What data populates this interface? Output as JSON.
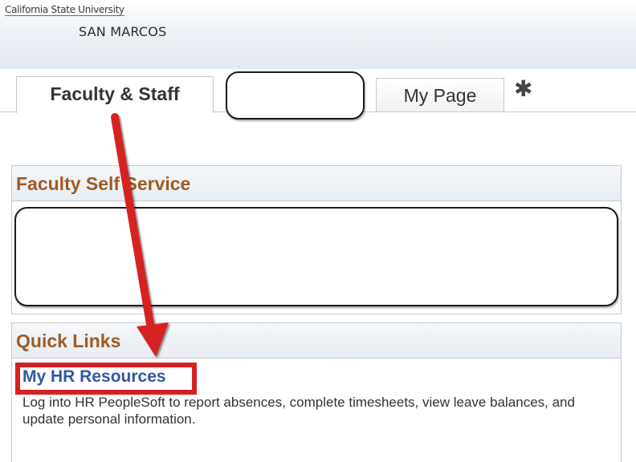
{
  "header": {
    "logo_line1": "California State University",
    "logo_line2": "SAN MARCOS"
  },
  "tabs": [
    {
      "label": "Faculty & Staff",
      "active": true
    },
    {
      "label": "",
      "redacted": true
    },
    {
      "label": "My Page",
      "active": false
    }
  ],
  "settings_icon": "gear-icon",
  "panels": {
    "faculty_self_service": {
      "title": "Faculty Self Service"
    },
    "quick_links": {
      "title": "Quick Links",
      "link_label": "My HR Resources",
      "description": "Log into HR PeopleSoft to report absences, complete timesheets, view leave balances, and update personal information."
    }
  },
  "annotation": {
    "color": "#d62020"
  },
  "colors": {
    "panel_title": "#a15a22",
    "link": "#2d5aa0"
  }
}
